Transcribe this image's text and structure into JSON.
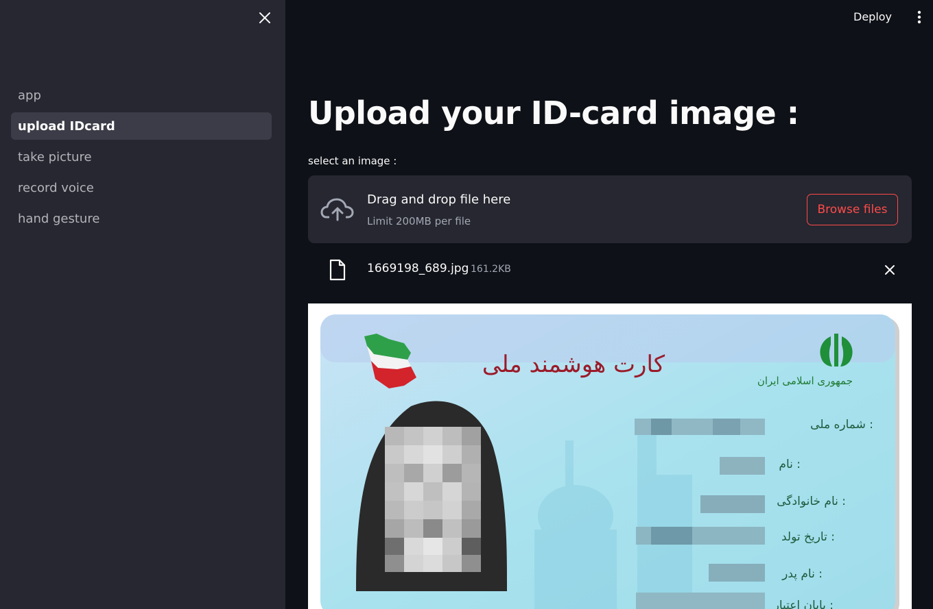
{
  "sidebar": {
    "items": [
      {
        "label": "app",
        "active": false
      },
      {
        "label": "upload IDcard",
        "active": true
      },
      {
        "label": "take picture",
        "active": false
      },
      {
        "label": "record voice",
        "active": false
      },
      {
        "label": "hand gesture",
        "active": false
      }
    ]
  },
  "header": {
    "deploy_label": "Deploy"
  },
  "main": {
    "title": "Upload your ID-card image :",
    "uploader": {
      "label": "select an image :",
      "drop_text": "Drag and drop file here",
      "limit_text": "Limit 200MB per file",
      "browse_label": "Browse files"
    },
    "file": {
      "name": "1669198_689.jpg",
      "size": "161.2KB"
    },
    "id_card": {
      "card_title": "کارت هوشمند ملی",
      "issuer": "جمهوری اسلامی ایران",
      "fields": [
        "شماره ملی :",
        "نام :",
        "نام خانوادگی :",
        "تاریخ تولد :",
        "نام پدر :",
        "پایان اعتبار :"
      ]
    }
  },
  "colors": {
    "accent": "#ff4b4b",
    "sidebar_bg": "#262730",
    "main_bg": "#0e1117",
    "card_bg": "#aee4ef"
  }
}
